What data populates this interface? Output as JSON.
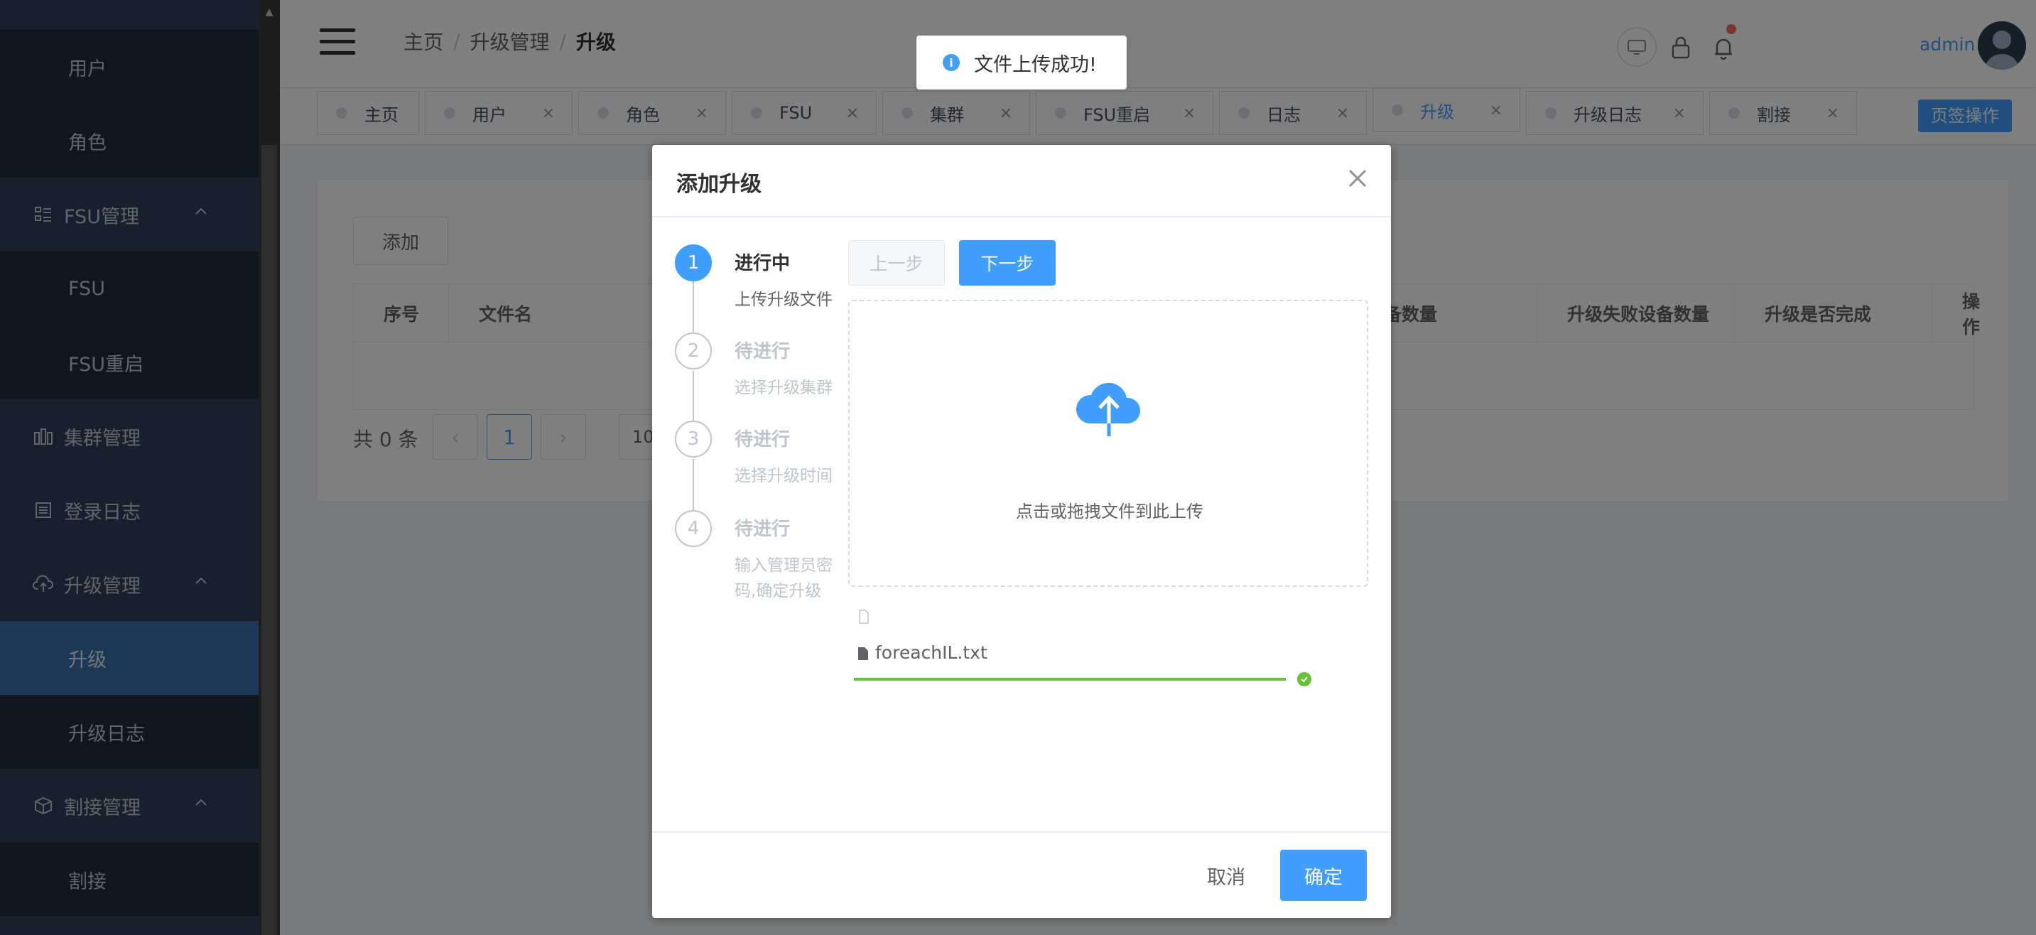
{
  "sidebar": {
    "items": [
      {
        "label": "用户",
        "kind": "sub"
      },
      {
        "label": "角色",
        "kind": "sub"
      },
      {
        "label": "FSU管理",
        "kind": "group",
        "icon": "list-icon"
      },
      {
        "label": "FSU",
        "kind": "sub"
      },
      {
        "label": "FSU重启",
        "kind": "sub"
      },
      {
        "label": "集群管理",
        "kind": "group",
        "icon": "cluster-icon"
      },
      {
        "label": "登录日志",
        "kind": "group",
        "icon": "log-icon"
      },
      {
        "label": "升级管理",
        "kind": "group",
        "icon": "cloud-upload-icon"
      },
      {
        "label": "升级",
        "kind": "sub",
        "active": true
      },
      {
        "label": "升级日志",
        "kind": "sub"
      },
      {
        "label": "割接管理",
        "kind": "group",
        "icon": "box-icon"
      },
      {
        "label": "割接",
        "kind": "sub"
      }
    ]
  },
  "navbar": {
    "breadcrumb": [
      "主页",
      "升级管理",
      "升级"
    ],
    "username": "admin"
  },
  "tags": {
    "items": [
      {
        "label": "主页",
        "closable": false
      },
      {
        "label": "用户",
        "closable": true
      },
      {
        "label": "角色",
        "closable": true
      },
      {
        "label": "FSU",
        "closable": true
      },
      {
        "label": "集群",
        "closable": true
      },
      {
        "label": "FSU重启",
        "closable": true
      },
      {
        "label": "日志",
        "closable": true
      },
      {
        "label": "升级",
        "closable": true,
        "active": true
      },
      {
        "label": "升级日志",
        "closable": true
      },
      {
        "label": "割接",
        "closable": true
      }
    ],
    "operation_label": "页签操作",
    "close_glyph": "×"
  },
  "page": {
    "add_label": "添加",
    "table_headers": [
      "序号",
      "文件名",
      "备数量",
      "升级失败设备数量",
      "升级是否完成",
      "操作"
    ],
    "total_label": "共 0 条",
    "prev_glyph": "‹",
    "next_glyph": "›",
    "current_page": "1",
    "page_size_fragment": "10"
  },
  "dialog": {
    "title": "添加升级",
    "steps": [
      {
        "number": "1",
        "title": "进行中",
        "description": "上传升级文件",
        "status": "process"
      },
      {
        "number": "2",
        "title": "待进行",
        "description": "选择升级集群",
        "status": "wait"
      },
      {
        "number": "3",
        "title": "待进行",
        "description": "选择升级时间",
        "status": "wait"
      },
      {
        "number": "4",
        "title": "待进行",
        "description": "输入管理员密码,确定升级",
        "status": "wait"
      }
    ],
    "prev_label": "上一步",
    "next_label": "下一步",
    "upload_hint": "点击或拖拽文件到此上传",
    "file_name": "foreachIL.txt",
    "upload_progress_percent": 100,
    "cancel_label": "取消",
    "confirm_label": "确定"
  },
  "toast": {
    "message": "文件上传成功!",
    "icon": "info-icon"
  },
  "colors": {
    "primary": "#409eff",
    "success": "#67c23a",
    "sidebar_bg": "#304156",
    "sidebar_sub_bg": "#1f2d3d",
    "sidebar_active": "#3a71a8"
  }
}
